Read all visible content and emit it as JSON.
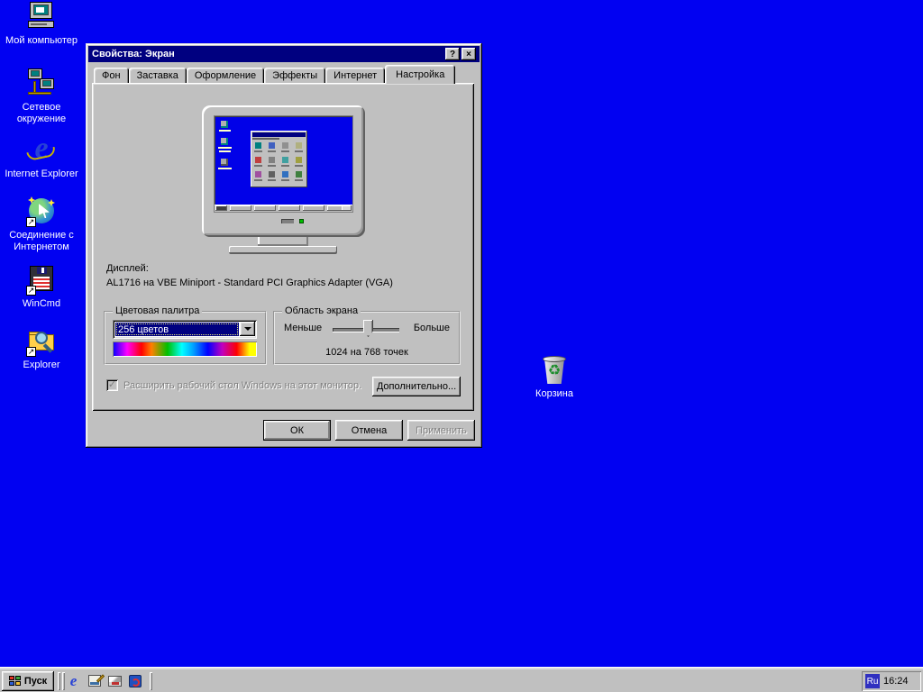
{
  "colors": {
    "desktop": "#0101f2",
    "titlebar": "#000080",
    "face": "#c0c0c0",
    "selection": "#000080"
  },
  "desktop": {
    "icons": [
      {
        "label": "Мой компьютер"
      },
      {
        "label": "Сетевое окружение"
      },
      {
        "label": "Internet Explorer"
      },
      {
        "label": "Соединение с Интернетом"
      },
      {
        "label": "WinCmd"
      },
      {
        "label": "Explorer"
      },
      {
        "label": "Корзина"
      }
    ]
  },
  "dialog": {
    "title": "Свойства: Экран",
    "help_button": "?",
    "close_button": "×",
    "tabs": [
      {
        "label": "Фон"
      },
      {
        "label": "Заставка"
      },
      {
        "label": "Оформление"
      },
      {
        "label": "Эффекты"
      },
      {
        "label": "Интернет"
      },
      {
        "label": "Настройка"
      }
    ],
    "display_label": "Дисплей:",
    "display_value": "AL1716 на VBE Miniport - Standard PCI Graphics Adapter (VGA)",
    "color_palette": {
      "title": "Цветовая палитра",
      "selected_option": "256 цветов"
    },
    "screen_area": {
      "title": "Область экрана",
      "less_label": "Меньше",
      "more_label": "Больше",
      "resolution": "1024 на 768 точек"
    },
    "extend_desktop_label": "Расширить рабочий стол Windows на этот монитор.",
    "checkbox_glyph": "✓",
    "advanced_button": "Дополнительно...",
    "ok_button": "ОК",
    "cancel_button": "Отмена",
    "apply_button": "Применить"
  },
  "taskbar": {
    "start_button": "Пуск",
    "quick_launch": [
      "internet-explorer",
      "show-desktop",
      "outlook-express",
      "view-channels"
    ],
    "tray": {
      "language": "Ru",
      "time": "16:24"
    }
  }
}
